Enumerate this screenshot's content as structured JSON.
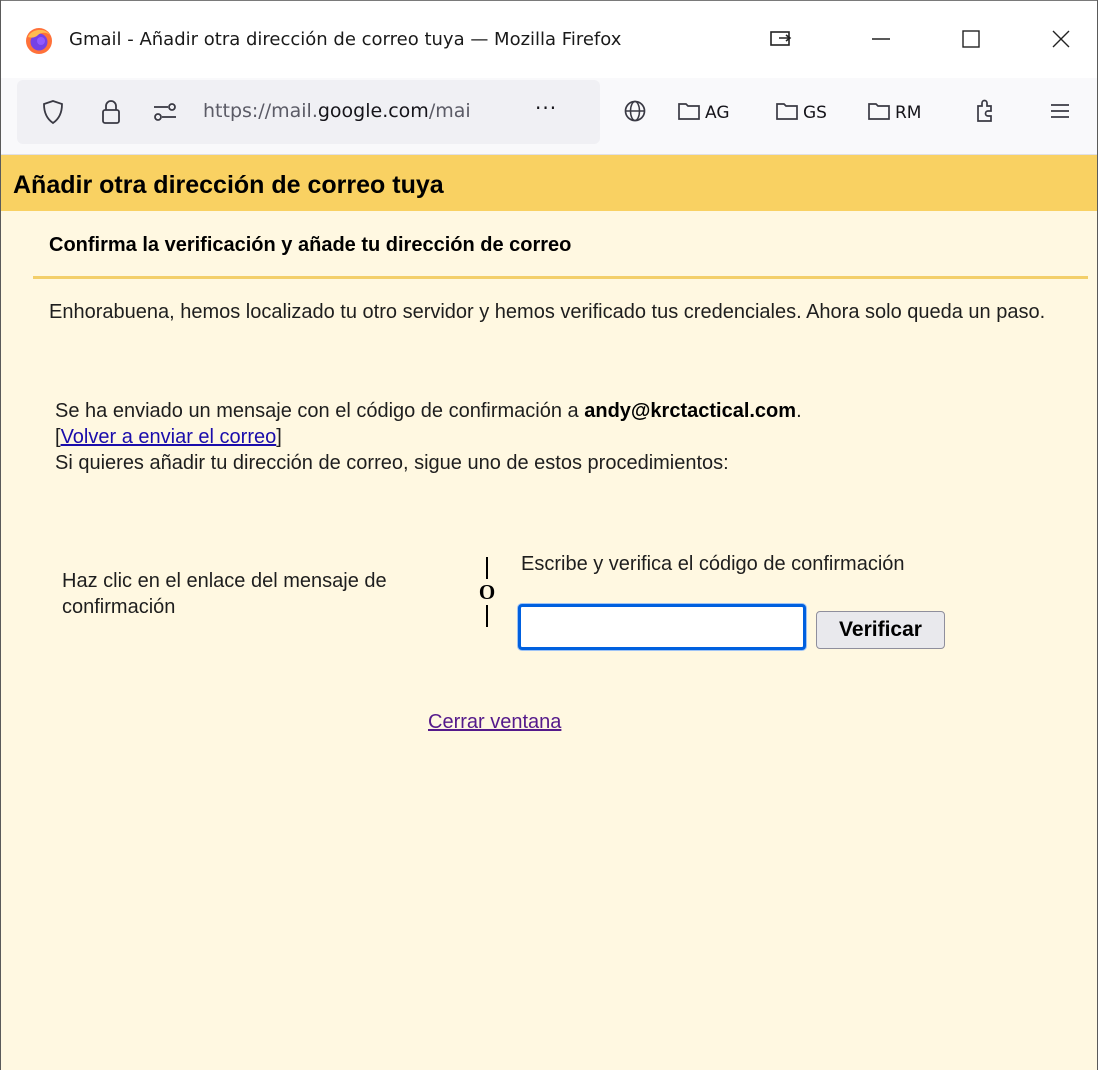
{
  "window": {
    "title": "Gmail - Añadir otra dirección de correo tuya — Mozilla Firefox"
  },
  "navbar": {
    "url_prefix": "https://mail.",
    "url_domain": "google.com",
    "url_suffix": "/mai",
    "more_label": "···",
    "bookmarks": [
      {
        "label": "AG",
        "icon": "folder-icon"
      },
      {
        "label": "GS",
        "icon": "folder-icon"
      },
      {
        "label": "RM",
        "icon": "folder-icon"
      }
    ]
  },
  "page": {
    "header_title": "Añadir otra dirección de correo tuya",
    "subheading": "Confirma la verificación y añade tu dirección de correo",
    "para1": "Enhorabuena, hemos localizado tu otro servidor y hemos verificado tus credenciales. Ahora solo queda un paso.",
    "sent_text": "Se ha enviado un mensaje con el código de confirmación a ",
    "email": "andy@krctactical.com",
    "sent_end": ".",
    "resend_open": "[",
    "resend_link": "Volver a enviar el correo",
    "resend_close": "]",
    "instructions": "Si quieres añadir tu dirección de correo, sigue uno de estos procedimientos:",
    "method_link": "Haz clic en el enlace del mensaje de confirmación",
    "separator_or": "O",
    "method_code": "Escribe y verifica el código de confirmación",
    "code_value": "",
    "verify_label": "Verificar",
    "close_link": "Cerrar ventana"
  },
  "colors": {
    "header_bg": "#f9d162",
    "page_bg": "#fff8e1",
    "link": "#1a0dab",
    "visited_link": "#551a8b",
    "focus": "#0060df"
  }
}
